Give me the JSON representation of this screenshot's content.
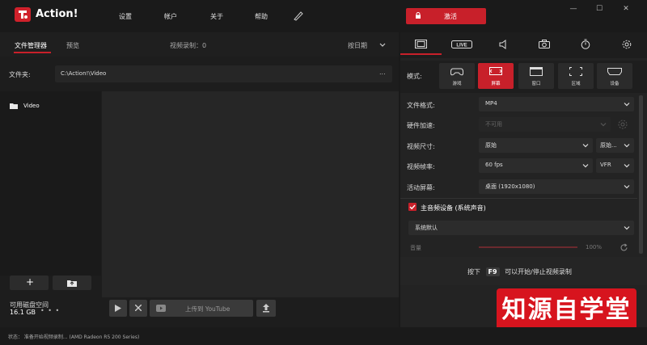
{
  "app": {
    "title": "Action!",
    "menu": [
      "设置",
      "帐户",
      "关于",
      "帮助"
    ],
    "activate_label": "激活",
    "window_controls": [
      "—",
      "☐",
      "✕"
    ]
  },
  "left": {
    "tabs": [
      "文件管理器",
      "预览",
      "视频录制：0",
      "按日期"
    ],
    "folder_label": "文件夹:",
    "folder_path": "C:\\Action!\\Video",
    "more": "...",
    "items": [
      "Video"
    ],
    "add_label": "+",
    "free_space_label": "可用磁盘空间",
    "free_space_value": "16.1 GB",
    "upload_label": "上传到 YouTube"
  },
  "right": {
    "mode_label": "模式:",
    "modes": [
      "游戏",
      "屏幕",
      "窗口",
      "区域",
      "设备"
    ],
    "settings": [
      {
        "label": "文件格式:",
        "value": "MP4"
      },
      {
        "label": "硬件加速:",
        "value": "不可用"
      },
      {
        "label": "视频尺寸:",
        "value": "原始",
        "value2": "原始..."
      },
      {
        "label": "视频帧率:",
        "value": "60 fps",
        "value2": "VFR"
      },
      {
        "label": "活动屏幕:",
        "value": "桌面 (1920x1080)"
      }
    ],
    "audio_device_label": "主音频设备 (系统声音)",
    "audio_device_value": "系统默认",
    "volume_label": "音量",
    "volume_value": "100%",
    "hint_prefix": "按下",
    "hint_key": "F9",
    "hint_suffix": "可以开始/停止视频录制"
  },
  "status": {
    "text": "状态：   准备开始视频录制...   (AMD Radeon R5 200 Series)"
  },
  "watermark": "知源自学堂",
  "colors": {
    "accent": "#c8202a"
  }
}
